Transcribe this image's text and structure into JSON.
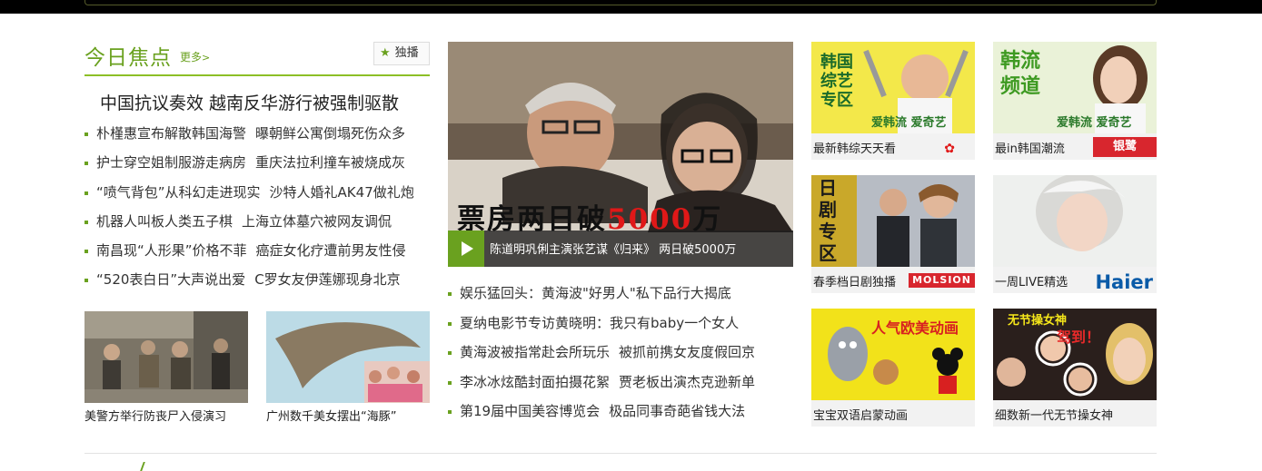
{
  "focus": {
    "title": "今日焦点",
    "more": "更多",
    "live_label": "独播",
    "headline": "中国抗议奏效 越南反华游行被强制驱散",
    "items": [
      [
        "朴槿惠宣布解散韩国海警",
        "曝朝鲜公寓倒塌死伤众多"
      ],
      [
        "护士穿空姐制服游走病房",
        "重庆法拉利撞车被烧成灰"
      ],
      [
        "“喷气背包”从科幻走进现实",
        "沙特人婚礼AK47做礼炮"
      ],
      [
        "机器人叫板人类五子棋",
        "上海立体墓穴被网友调侃"
      ],
      [
        "南昌现“人形果”价格不菲",
        "癌症女化疗遭前男友性侵"
      ],
      [
        "“520表白日”大声说出爱",
        "C罗女友伊莲娜现身北京"
      ]
    ],
    "thumbs": [
      {
        "caption": "美警方举行防丧尸入侵演习"
      },
      {
        "caption": "广州数千美女摆出“海豚”"
      }
    ]
  },
  "feature": {
    "overlay_text_1": "票房两日破",
    "overlay_text_red": "5000",
    "overlay_text_2": "万",
    "caption": "陈道明巩俐主演张艺谋《归来》 两日破5000万"
  },
  "center_list": [
    [
      "娱乐猛回头：黄海波\"好男人\"私下品行大揭底"
    ],
    [
      "夏纳电影节专访黄晓明：我只有baby一个女人"
    ],
    [
      "黄海波被指常赴会所玩乐",
      "被抓前携女友度假回京"
    ],
    [
      "李冰冰炫酷封面拍摄花絮",
      "贾老板出演杰克逊新单"
    ],
    [
      "第19届中国美容博览会",
      "极品同事奇葩省钱大法"
    ]
  ],
  "cards": [
    {
      "caption": "最新韩综天天看",
      "img_text": "韩国综艺专区",
      "img_sub": "爱韩流 爱奇艺",
      "brand": "",
      "brand_color": "#d8262e"
    },
    {
      "caption": "最in韩国潮流",
      "img_text": "韩流频道",
      "img_sub": "爱韩流 爱奇艺",
      "brand": "银鹭",
      "brand_color": "#d8262e"
    },
    {
      "caption": "春季档日剧独播",
      "img_text": "日剧专区",
      "img_sub": "",
      "brand": "MOLSION",
      "brand_color": "#d8262e"
    },
    {
      "caption": "一周LIVE精选",
      "img_text": "",
      "img_sub": "",
      "brand": "Haier",
      "brand_color": "#0a5ba8"
    },
    {
      "caption": "宝宝双语启蒙动画",
      "img_text": "人气欧美动画",
      "img_sub": "",
      "brand": "",
      "brand_color": ""
    },
    {
      "caption": "细数新一代无节操女神",
      "img_text": "无节操女神",
      "img_sub": "驾到！",
      "brand": "",
      "brand_color": ""
    }
  ],
  "colors": {
    "accent": "#6aa11f",
    "rule": "#8cbf26",
    "red": "#e01818"
  }
}
